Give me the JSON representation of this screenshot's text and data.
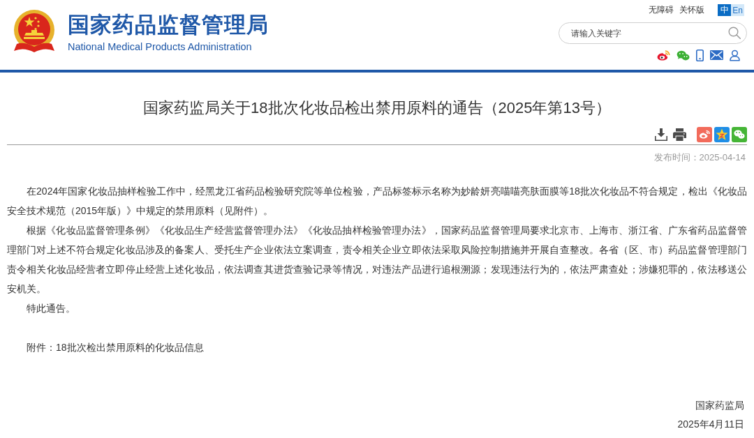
{
  "header": {
    "site_title": "国家药品监督管理局",
    "site_subtitle": "National Medical Products Administration",
    "top_links": [
      "无障碍",
      "关怀版"
    ],
    "languages": [
      {
        "label": "中",
        "selected": true
      },
      {
        "label": "En",
        "selected": false
      }
    ],
    "search": {
      "placeholder": "请输入关键字"
    },
    "social_links": [
      {
        "kind": "weibo"
      },
      {
        "kind": "wechat"
      },
      {
        "kind": "mobile"
      },
      {
        "kind": "mail"
      },
      {
        "kind": "user"
      }
    ]
  },
  "article": {
    "title": "国家药监局关于18批次化妆品检出禁用原料的通告（2025年第13号）",
    "tools": [
      {
        "kind": "download"
      },
      {
        "kind": "print"
      }
    ],
    "share": [
      {
        "kind": "weibo"
      },
      {
        "kind": "qzone"
      },
      {
        "kind": "wechat"
      }
    ],
    "published": "发布时间：2025-04-14",
    "paragraphs": [
      "在2024年国家化妆品抽样检验工作中，经黑龙江省药品检验研究院等单位检验，产品标签标示名称为妙龄妍亮喵喵亮肤面膜等18批次化妆品不符合规定，检出《化妆品安全技术规范（2015年版）》中规定的禁用原料（见附件）。",
      "根据《化妆品监督管理条例》《化妆品生产经营监督管理办法》《化妆品抽样检验管理办法》，国家药品监督管理局要求北京市、上海市、浙江省、广东省药品监督管理部门对上述不符合规定化妆品涉及的备案人、受托生产企业依法立案调查，责令相关企业立即依法采取风险控制措施并开展自查整改。各省（区、市）药品监督管理部门责令相关化妆品经营者立即停止经营上述化妆品，依法调查其进货查验记录等情况，对违法产品进行追根溯源；发现违法行为的，依法严肃查处；涉嫌犯罪的，依法移送公安机关。",
      "特此通告。"
    ],
    "attachment": "附件：18批次检出禁用原料的化妆品信息",
    "signature": [
      "国家药监局",
      "2025年4月11日"
    ]
  }
}
